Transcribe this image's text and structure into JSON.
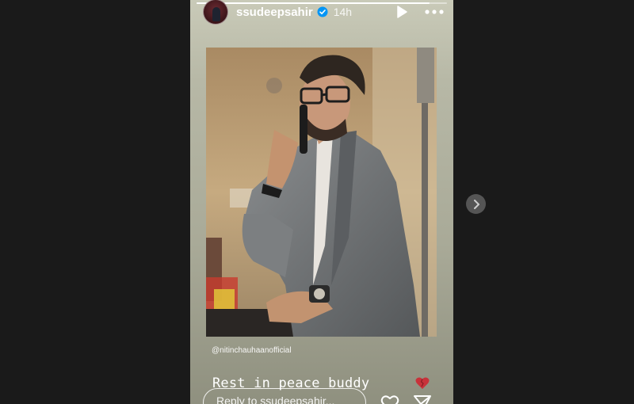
{
  "story": {
    "username": "ssudeepsahir",
    "timestamp": "14h",
    "progress": 0.93,
    "photo_mention": "@nitinchauhaanofficial",
    "caption": "Rest in peace buddy",
    "caption_emoji": "broken-heart-icon",
    "reply_placeholder": "Reply to ssudeepsahir..."
  },
  "icons": {
    "verified": "verified-badge-icon",
    "play": "play-icon",
    "more": "more-options-icon",
    "like": "heart-icon",
    "share": "paper-plane-icon",
    "next": "chevron-right-icon"
  },
  "colors": {
    "page_background": "#1a1a1a",
    "story_background": "#b7b8a6",
    "verified_blue": "#0095f6",
    "broken_heart_red": "#c8323a",
    "next_button": "#555555"
  }
}
